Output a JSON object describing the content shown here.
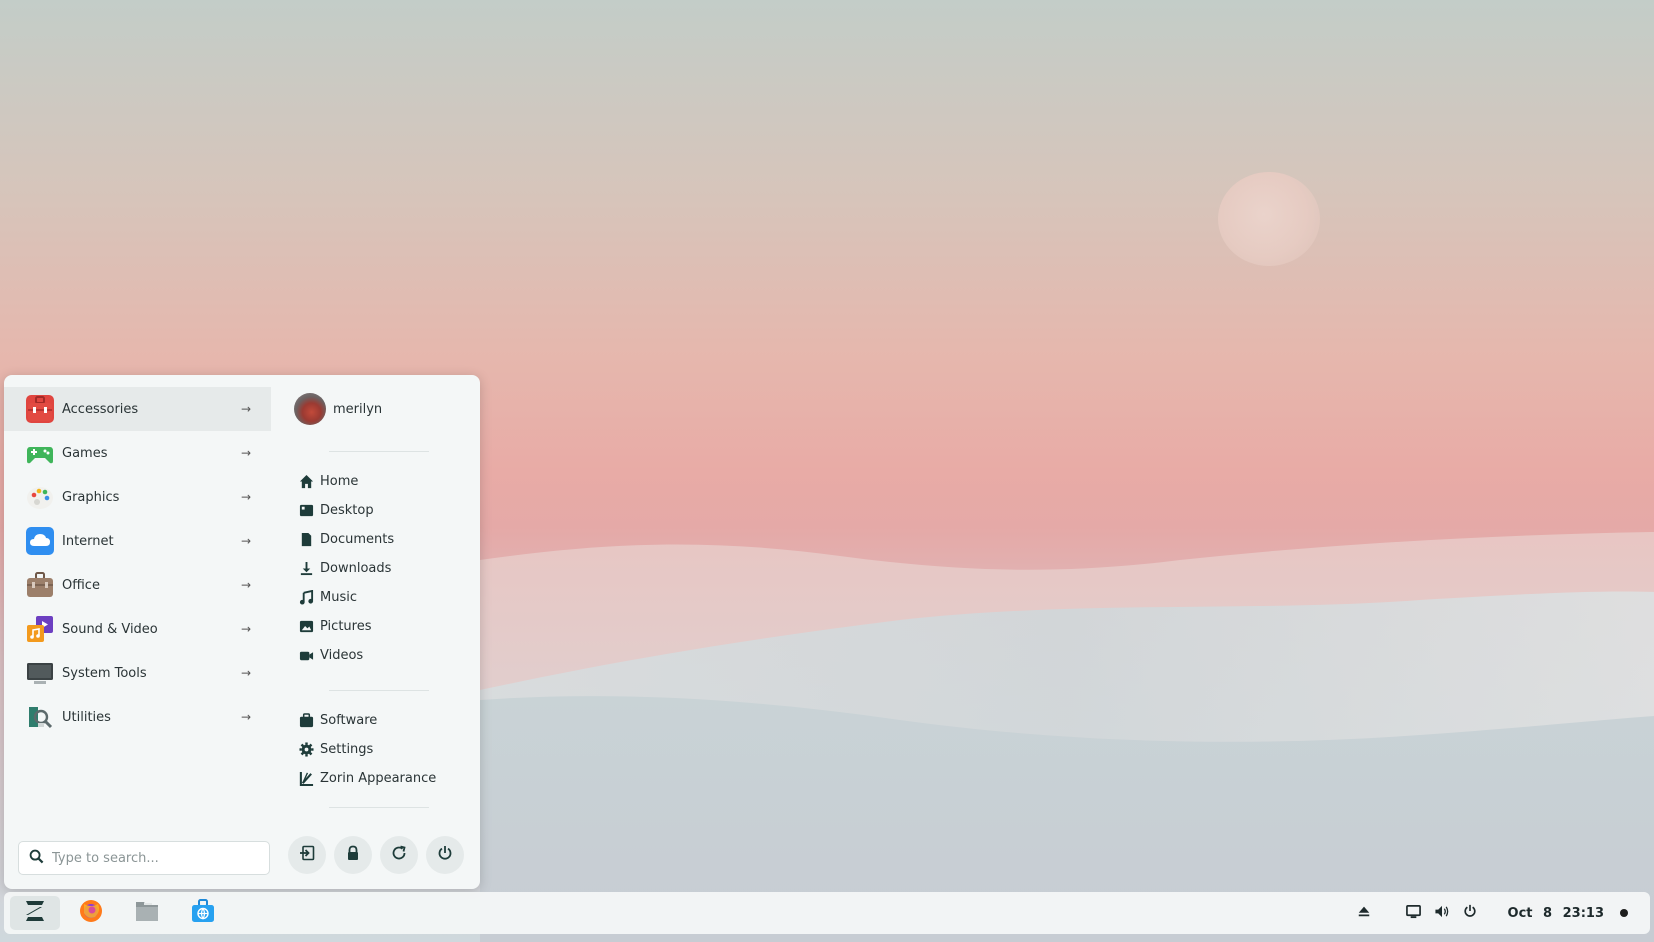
{
  "categories": [
    {
      "label": "Accessories",
      "icon": "accessories-icon"
    },
    {
      "label": "Games",
      "icon": "games-icon"
    },
    {
      "label": "Graphics",
      "icon": "graphics-icon"
    },
    {
      "label": "Internet",
      "icon": "internet-icon"
    },
    {
      "label": "Office",
      "icon": "office-icon"
    },
    {
      "label": "Sound & Video",
      "icon": "sound-video-icon"
    },
    {
      "label": "System Tools",
      "icon": "system-tools-icon"
    },
    {
      "label": "Utilities",
      "icon": "utilities-icon"
    }
  ],
  "user": {
    "name": "merilyn"
  },
  "places": [
    {
      "label": "Home",
      "icon": "home-icon"
    },
    {
      "label": "Desktop",
      "icon": "desktop-icon"
    },
    {
      "label": "Documents",
      "icon": "documents-icon"
    },
    {
      "label": "Downloads",
      "icon": "downloads-icon"
    },
    {
      "label": "Music",
      "icon": "music-icon"
    },
    {
      "label": "Pictures",
      "icon": "pictures-icon"
    },
    {
      "label": "Videos",
      "icon": "videos-icon"
    }
  ],
  "system": [
    {
      "label": "Software",
      "icon": "software-icon"
    },
    {
      "label": "Settings",
      "icon": "settings-icon"
    },
    {
      "label": "Zorin Appearance",
      "icon": "zorin-appearance-icon"
    }
  ],
  "search": {
    "placeholder": "Type to search..."
  },
  "taskbar": {
    "date": "Oct 8",
    "time": "23:13"
  },
  "colors": {
    "accent": "#1e3c3a",
    "panel": "#f4f7f7",
    "active_row": "#e6eaea"
  }
}
